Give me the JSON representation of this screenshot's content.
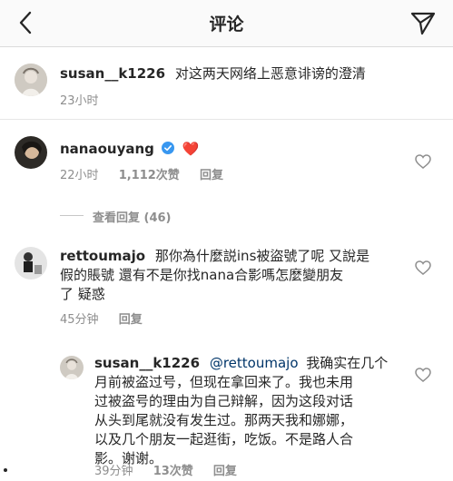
{
  "header": {
    "title": "评论"
  },
  "caption": {
    "username": "susan__k1226",
    "text": "对这两天网络上恶意诽谤的澄清",
    "time": "23小时"
  },
  "comments": [
    {
      "username": "nanaouyang",
      "verified": true,
      "text": "❤️",
      "time": "22小时",
      "likes": "1,112次赞",
      "reply_label": "回复",
      "view_replies": "查看回复 (46)"
    },
    {
      "username": "rettoumajo",
      "text_lines": [
        "那你為什麼説ins被盜號了呢 又說是",
        "假的賬號 還有不是你找nana合影嗎怎麼變朋友",
        "了 疑惑"
      ],
      "time": "45分钟",
      "reply_label": "回复"
    }
  ],
  "reply": {
    "username": "susan__k1226",
    "mention": "@rettoumajo",
    "text_lines": [
      "我确实在几个",
      "月前被盗过号，但现在拿回来了。我也未用",
      "过被盗号的理由为自己辩解，因为这段对话",
      "从头到尾就没有发生过。那两天我和娜娜，",
      "以及几个朋友一起逛街，吃饭。不是路人合",
      "影。谢谢。"
    ],
    "time": "39分钟",
    "likes": "13次赞",
    "reply_label": "回复"
  },
  "colors": {
    "text": "#262626",
    "secondary": "#8e8e8e",
    "verified_blue": "#3897f0",
    "heart_red": "#ed4956",
    "divider": "#dbdbdb",
    "header_bg": "#fafafa"
  },
  "icons": {
    "back": "chevron-left-icon",
    "share": "paper-plane-icon",
    "like": "heart-outline-icon",
    "verified": "verified-badge-icon"
  }
}
